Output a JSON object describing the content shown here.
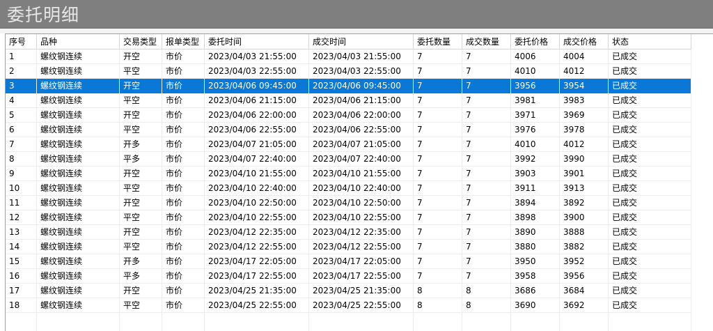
{
  "window": {
    "title": "委托明细"
  },
  "table": {
    "columns": [
      "序号",
      "品种",
      "交易类型",
      "报单类型",
      "委托时间",
      "成交时间",
      "委托数量",
      "成交数量",
      "委托价格",
      "成交价格",
      "状态"
    ],
    "selected_row": 2,
    "rows": [
      [
        "1",
        "螺纹钢连续",
        "开空",
        "市价",
        "2023/04/03 21:55:00",
        "2023/04/03 21:55:00",
        "7",
        "7",
        "4006",
        "4004",
        "已成交"
      ],
      [
        "2",
        "螺纹钢连续",
        "平空",
        "市价",
        "2023/04/03 22:55:00",
        "2023/04/03 22:55:00",
        "7",
        "7",
        "4010",
        "4012",
        "已成交"
      ],
      [
        "3",
        "螺纹钢连续",
        "开空",
        "市价",
        "2023/04/06 09:45:00",
        "2023/04/06 09:45:00",
        "7",
        "7",
        "3956",
        "3954",
        "已成交"
      ],
      [
        "4",
        "螺纹钢连续",
        "平空",
        "市价",
        "2023/04/06 21:15:00",
        "2023/04/06 21:15:00",
        "7",
        "7",
        "3981",
        "3983",
        "已成交"
      ],
      [
        "5",
        "螺纹钢连续",
        "开空",
        "市价",
        "2023/04/06 22:00:00",
        "2023/04/06 22:00:00",
        "7",
        "7",
        "3971",
        "3969",
        "已成交"
      ],
      [
        "6",
        "螺纹钢连续",
        "平空",
        "市价",
        "2023/04/06 22:55:00",
        "2023/04/06 22:55:00",
        "7",
        "7",
        "3976",
        "3978",
        "已成交"
      ],
      [
        "7",
        "螺纹钢连续",
        "开多",
        "市价",
        "2023/04/07 21:05:00",
        "2023/04/07 21:05:00",
        "7",
        "7",
        "4010",
        "4012",
        "已成交"
      ],
      [
        "8",
        "螺纹钢连续",
        "平多",
        "市价",
        "2023/04/07 22:40:00",
        "2023/04/07 22:40:00",
        "7",
        "7",
        "3992",
        "3990",
        "已成交"
      ],
      [
        "9",
        "螺纹钢连续",
        "开空",
        "市价",
        "2023/04/10 21:55:00",
        "2023/04/10 21:55:00",
        "7",
        "7",
        "3903",
        "3901",
        "已成交"
      ],
      [
        "10",
        "螺纹钢连续",
        "平空",
        "市价",
        "2023/04/10 22:40:00",
        "2023/04/10 22:40:00",
        "7",
        "7",
        "3911",
        "3913",
        "已成交"
      ],
      [
        "11",
        "螺纹钢连续",
        "开空",
        "市价",
        "2023/04/10 22:50:00",
        "2023/04/10 22:50:00",
        "7",
        "7",
        "3894",
        "3892",
        "已成交"
      ],
      [
        "12",
        "螺纹钢连续",
        "平空",
        "市价",
        "2023/04/10 22:55:00",
        "2023/04/10 22:55:00",
        "7",
        "7",
        "3898",
        "3900",
        "已成交"
      ],
      [
        "13",
        "螺纹钢连续",
        "开空",
        "市价",
        "2023/04/12 22:35:00",
        "2023/04/12 22:35:00",
        "7",
        "7",
        "3890",
        "3888",
        "已成交"
      ],
      [
        "14",
        "螺纹钢连续",
        "平空",
        "市价",
        "2023/04/12 22:55:00",
        "2023/04/12 22:55:00",
        "7",
        "7",
        "3880",
        "3882",
        "已成交"
      ],
      [
        "15",
        "螺纹钢连续",
        "开多",
        "市价",
        "2023/04/17 22:05:00",
        "2023/04/17 22:05:00",
        "7",
        "7",
        "3950",
        "3952",
        "已成交"
      ],
      [
        "16",
        "螺纹钢连续",
        "平多",
        "市价",
        "2023/04/17 22:55:00",
        "2023/04/17 22:55:00",
        "7",
        "7",
        "3958",
        "3956",
        "已成交"
      ],
      [
        "17",
        "螺纹钢连续",
        "开空",
        "市价",
        "2023/04/25 21:35:00",
        "2023/04/25 21:35:00",
        "8",
        "8",
        "3686",
        "3684",
        "已成交"
      ],
      [
        "18",
        "螺纹钢连续",
        "平空",
        "市价",
        "2023/04/25 22:55:00",
        "2023/04/25 22:55:00",
        "8",
        "8",
        "3690",
        "3692",
        "已成交"
      ]
    ]
  },
  "colors": {
    "selection": "#0a78d7",
    "titlebar": "#7f7f7f"
  }
}
